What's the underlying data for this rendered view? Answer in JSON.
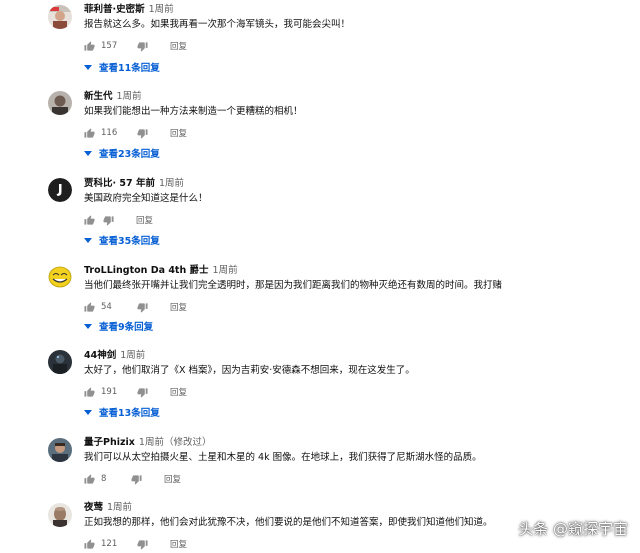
{
  "comments": [
    {
      "author": "菲利普·史密斯",
      "time": "1周前",
      "text": "报告就这么多。如果我再看一次那个海军镜头，我可能会尖叫！",
      "likes": "157",
      "reply_label": "回复",
      "replies_label": "查看11条回复",
      "avatar": "portrait-photo"
    },
    {
      "author": "新生代",
      "time": "1周前",
      "text": "如果我们能想出一种方法来制造一个更糟糕的相机！",
      "likes": "116",
      "reply_label": "回复",
      "replies_label": "查看23条回复",
      "avatar": "man-portrait"
    },
    {
      "author": "贾科比· 57 年前",
      "time": "1周前",
      "text": "美国政府完全知道这是什么！",
      "likes": "",
      "reply_label": "回复",
      "replies_label": "查看35条回复",
      "avatar": "letter-j-logo"
    },
    {
      "author": "TroLLington Da 4th 爵士",
      "time": "1周前",
      "text": "当他们最终张开嘴并让我们完全透明时，那是因为我们距离我们的物种灭绝还有数周的时间。我打赌",
      "likes": "54",
      "reply_label": "回复",
      "replies_label": "查看9条回复",
      "avatar": "trollface"
    },
    {
      "author": "44神剑",
      "time": "1周前",
      "text": "太好了，他们取消了《X 档案》，因为吉莉安·安德森不想回来，现在这发生了。",
      "likes": "191",
      "reply_label": "回复",
      "replies_label": "查看13条回复",
      "avatar": "dark-figure"
    },
    {
      "author": "量子Phizix",
      "time": "1周前（修改过）",
      "text": "我们可以从太空拍摄火星、土星和木星的 4k 图像。在地球上，我们获得了尼斯湖水怪的品质。",
      "likes": "8",
      "reply_label": "回复",
      "replies_label": "",
      "avatar": "man-photo"
    },
    {
      "author": "夜莺",
      "time": "1周前",
      "text": "正如我想的那样，他们会对此犹豫不决，他们要说的是他们不知道答案，即使我们知道他们知道。",
      "likes": "121",
      "reply_label": "回复",
      "replies_label": "",
      "avatar": "bald-man"
    }
  ],
  "watermark": "头条 @窥探宇宙",
  "colors": {
    "link": "#065fd4",
    "muted": "#606060",
    "icon": "#909090"
  }
}
